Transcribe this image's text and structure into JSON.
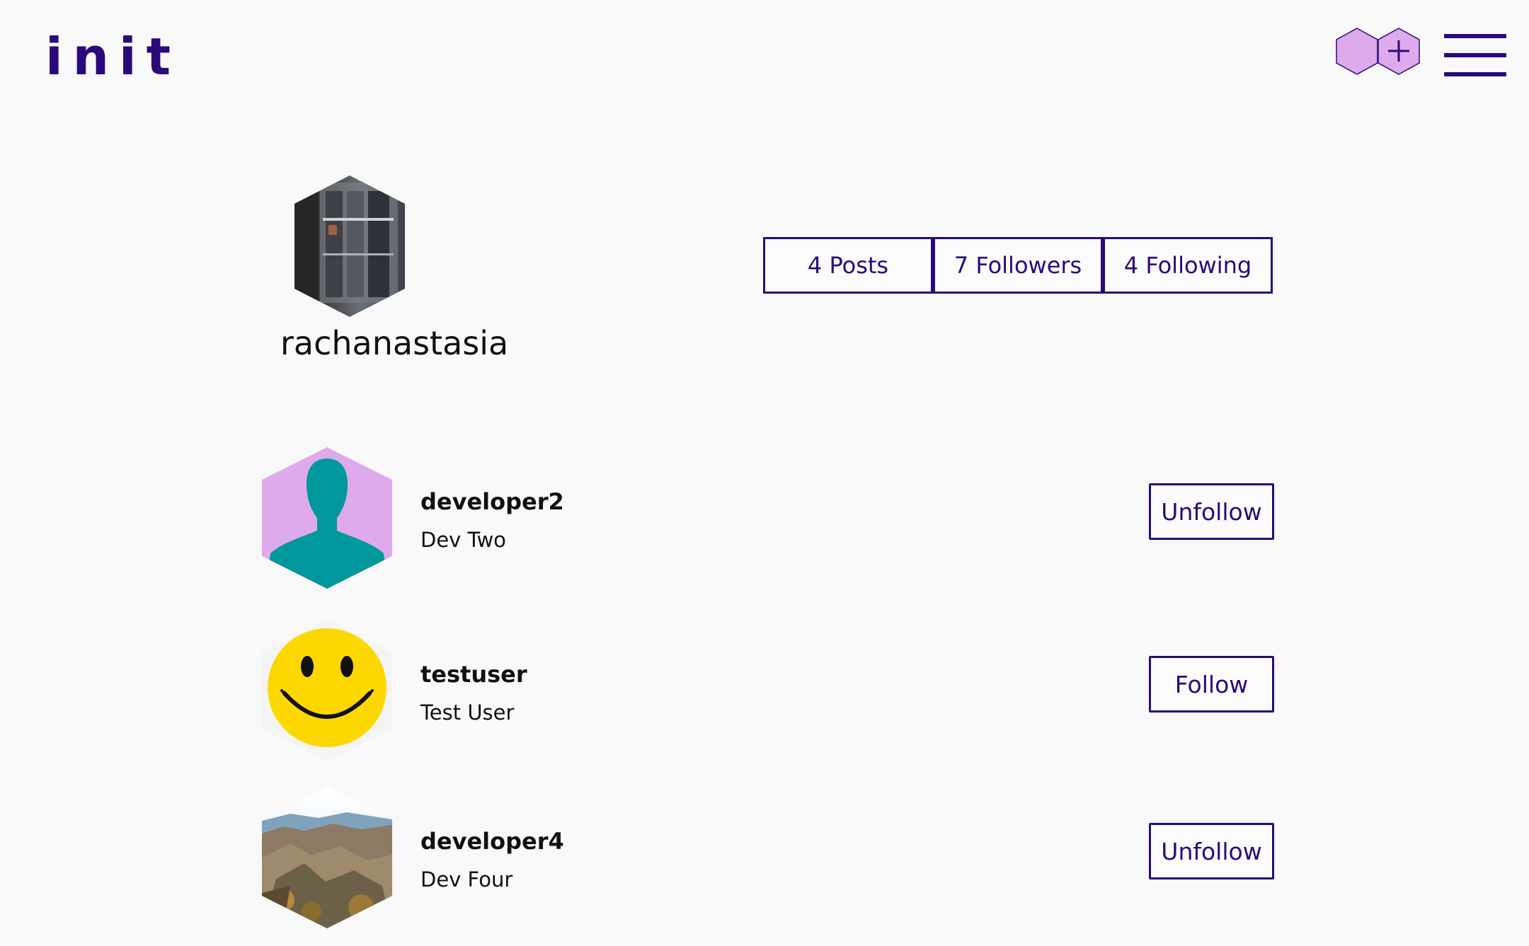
{
  "app": {
    "logo": "init"
  },
  "header": {
    "new_post_icon": "plus-hexagon-icon",
    "menu_icon": "hamburger-menu-icon"
  },
  "profile": {
    "username": "rachanastasia",
    "stats": {
      "posts": "4 Posts",
      "followers": "7 Followers",
      "following": "4 Following"
    }
  },
  "following_list": [
    {
      "username": "developer2",
      "full_name": "Dev Two",
      "action": "Unfollow",
      "avatar": "default-silhouette"
    },
    {
      "username": "testuser",
      "full_name": "Test User",
      "action": "Follow",
      "avatar": "smiley-face"
    },
    {
      "username": "developer4",
      "full_name": "Dev Four",
      "action": "Unfollow",
      "avatar": "mountain-landscape"
    }
  ],
  "colors": {
    "brand": "#2a0a7a",
    "hex_fill": "#dfaaeb",
    "silhouette": "#00989c",
    "smiley": "#fcd800",
    "background": "#f9f9f9"
  }
}
